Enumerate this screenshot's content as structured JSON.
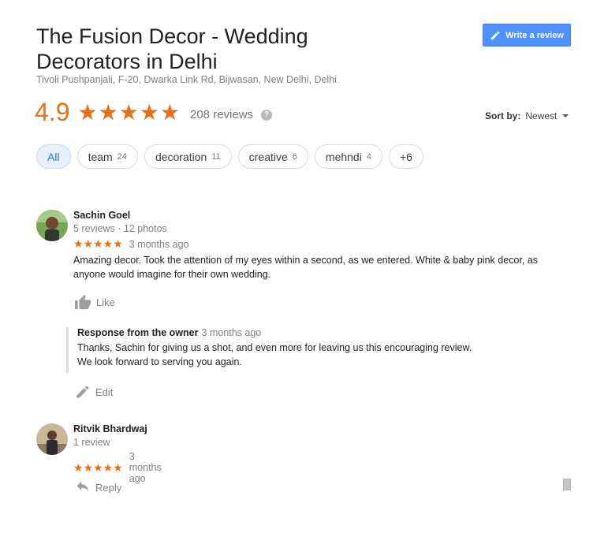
{
  "business": {
    "name": "The Fusion Decor - Wedding Decorators in Delhi",
    "address": "Tivoli Pushpanjali, F-20, Dwarka Link Rd, Bijwasan, New Delhi, Delhi",
    "write_review_label": "Write a review"
  },
  "rating": {
    "score": "4.9",
    "stars": "★★★★★",
    "review_count": "208 reviews",
    "help_glyph": "?"
  },
  "sort": {
    "label": "Sort by:",
    "value": "Newest"
  },
  "filters": [
    {
      "label": "All",
      "count": "",
      "active": true
    },
    {
      "label": "team",
      "count": "24"
    },
    {
      "label": "decoration",
      "count": "11"
    },
    {
      "label": "creative",
      "count": "6"
    },
    {
      "label": "mehndi",
      "count": "4"
    },
    {
      "label": "+6",
      "count": ""
    }
  ],
  "reviews": [
    {
      "name": "Sachin Goel",
      "meta": "5 reviews · 12 photos",
      "stars": "★★★★★",
      "time": "3 months ago",
      "text": "Amazing decor. Took the attention of my eyes within a second, as we entered. White & baby pink decor, as anyone would imagine for their own wedding.",
      "action_label": "Like",
      "owner_response": {
        "heading": "Response from the owner",
        "time": "3 months ago",
        "line1": "Thanks, Sachin for giving us a shot, and even more for leaving us this encouraging review.",
        "line2": "We look forward to serving you again.",
        "edit_label": "Edit"
      }
    },
    {
      "name": "Ritvik Bhardwaj",
      "meta": "1 review",
      "stars": "★★★★★",
      "time": "3 months ago",
      "action_label": "Reply"
    }
  ],
  "colors": {
    "accent_orange": "#e7711b",
    "button_blue": "#4d90fe",
    "chip_active_bg": "#e8f0fe"
  },
  "icons": {
    "write_review": "pencil-icon",
    "like": "thumbs-up-icon",
    "edit": "pencil-icon",
    "reply": "reply-arrow-icon",
    "sort_caret": "caret-down-icon",
    "help": "question-circle-icon"
  }
}
